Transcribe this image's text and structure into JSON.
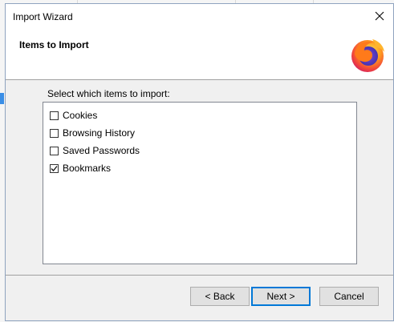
{
  "dialog": {
    "title": "Import Wizard",
    "header_title": "Items to Import",
    "instruction": "Select which items to import:",
    "items": [
      {
        "label": "Cookies",
        "checked": false
      },
      {
        "label": "Browsing History",
        "checked": false
      },
      {
        "label": "Saved Passwords",
        "checked": false
      },
      {
        "label": "Bookmarks",
        "checked": true
      }
    ],
    "buttons": {
      "back": "< Back",
      "next": "Next >",
      "cancel": "Cancel"
    }
  },
  "icons": {
    "close": "close-icon",
    "logo": "firefox-logo"
  },
  "colors": {
    "default_button_border": "#0078d7",
    "dialog_background": "#f0f0f0",
    "header_background": "#ffffff"
  }
}
